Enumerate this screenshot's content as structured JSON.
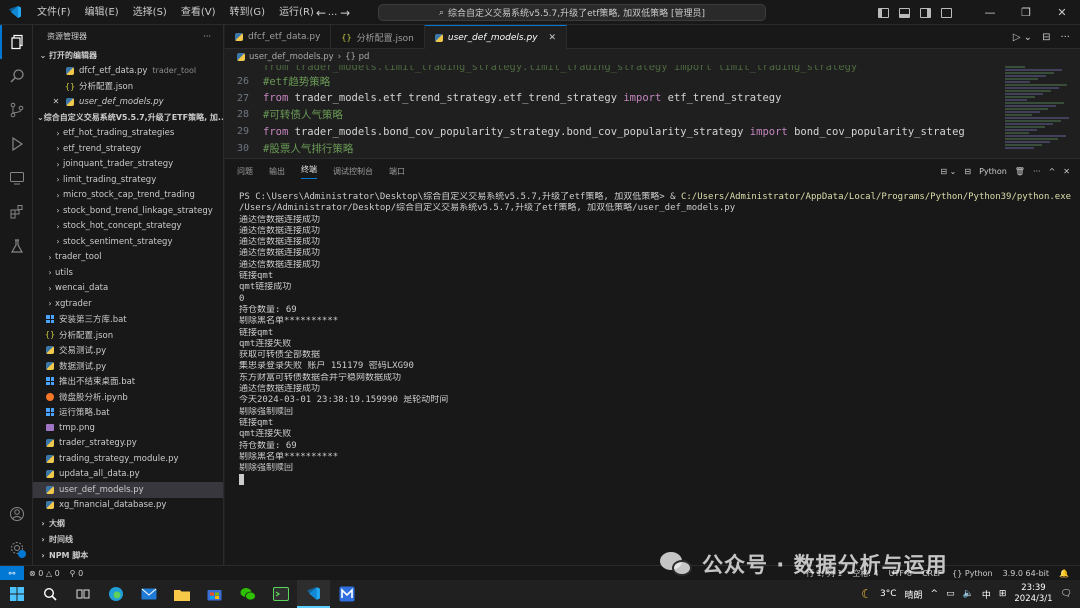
{
  "titlebar": {
    "menu": [
      "文件(F)",
      "编辑(E)",
      "选择(S)",
      "查看(V)",
      "转到(G)",
      "运行(R)",
      "..."
    ],
    "command_center": "综合自定义交易系统v5.5.7,升级了etf策略, 加双低策略 [管理员]"
  },
  "sidebar": {
    "title": "资源管理器",
    "open_editors_title": "打开的编辑器",
    "open_editors": [
      {
        "name": "dfcf_etf_data.py",
        "hint": "trader_tool",
        "icon": "python-file-icon"
      },
      {
        "name": "分析配置.json",
        "hint": "",
        "icon": "json-file-icon"
      },
      {
        "name": "user_def_models.py",
        "hint": "",
        "icon": "python-file-icon",
        "close": "✕"
      }
    ],
    "workspace_title": "综合自定义交易系统V5.5.7,升级了ETF策略, 加...",
    "tree": [
      {
        "name": "etf_hot_trading_strategies",
        "type": "folder"
      },
      {
        "name": "etf_trend_strategy",
        "type": "folder"
      },
      {
        "name": "joinquant_trader_strategy",
        "type": "folder"
      },
      {
        "name": "limit_trading_strategy",
        "type": "folder"
      },
      {
        "name": "micro_stock_cap_trend_trading",
        "type": "folder"
      },
      {
        "name": "stock_bond_trend_linkage_strategy",
        "type": "folder"
      },
      {
        "name": "stock_hot_concept_strategy",
        "type": "folder"
      },
      {
        "name": "stock_sentiment_strategy",
        "type": "folder"
      }
    ],
    "root_items": [
      {
        "name": "trader_tool",
        "type": "folder"
      },
      {
        "name": "utils",
        "type": "folder"
      },
      {
        "name": "wencai_data",
        "type": "folder"
      },
      {
        "name": "xgtrader",
        "type": "folder"
      },
      {
        "name": "安装第三方库.bat",
        "type": "bat"
      },
      {
        "name": "分析配置.json",
        "type": "json"
      },
      {
        "name": "交易测试.py",
        "type": "py"
      },
      {
        "name": "数据测试.py",
        "type": "py"
      },
      {
        "name": "推出不结束桌面.bat",
        "type": "bat"
      },
      {
        "name": "微盘股分析.ipynb",
        "type": "ipynb"
      },
      {
        "name": "运行策略.bat",
        "type": "bat"
      },
      {
        "name": "tmp.png",
        "type": "png"
      },
      {
        "name": "trader_strategy.py",
        "type": "py"
      },
      {
        "name": "trading_strategy_module.py",
        "type": "py"
      },
      {
        "name": "updata_all_data.py",
        "type": "py"
      },
      {
        "name": "user_def_models.py",
        "type": "py",
        "selected": true
      },
      {
        "name": "xg_financial_database.py",
        "type": "py"
      }
    ],
    "bottom_sections": [
      "大纲",
      "时间线",
      "NPM 脚本"
    ]
  },
  "editor": {
    "tabs": [
      {
        "label": "dfcf_etf_data.py",
        "active": false
      },
      {
        "label": "分析配置.json",
        "active": false
      },
      {
        "label": "user_def_models.py",
        "active": true
      }
    ],
    "breadcrumb": [
      "user_def_models.py",
      "{} pd"
    ],
    "lines": [
      {
        "num": "26",
        "kind": "comment",
        "text": "#etf趋势策略"
      },
      {
        "num": "27",
        "kind": "import",
        "from": "from",
        "module": "trader_models.etf_trend_strategy.etf_trend_strategy",
        "imp": "import",
        "name": "etf_trend_strategy"
      },
      {
        "num": "28",
        "kind": "comment",
        "text": "#可转债人气策略"
      },
      {
        "num": "29",
        "kind": "import",
        "from": "from",
        "module": "trader_models.bond_cov_popularity_strategy.bond_cov_popularity_strategy",
        "imp": "import",
        "name": "bond_cov_popularity_strateg"
      },
      {
        "num": "30",
        "kind": "comment",
        "text": "#股票人气排行策略"
      }
    ]
  },
  "panel": {
    "tabs": [
      "问题",
      "输出",
      "终端",
      "调试控制台",
      "端口"
    ],
    "active_tab": "终端",
    "shell_label": "Python",
    "prompt": "PS C:\\Users\\Administrator\\Desktop\\综合自定义交易系统v5.5.7,升级了etf策略, 加双低策略> & ",
    "python_path": "C:/Users/Administrator/AppData/Local/Programs/Python/Python39/python.exe",
    "prompt_tail": " c:",
    "script_path": "/Users/Administrator/Desktop/综合自定义交易系统v5.5.7,升级了etf策略, 加双低策略/user_def_models.py",
    "output": [
      "通达信数据连接成功",
      "通达信数据连接成功",
      "通达信数据连接成功",
      "通达信数据连接成功",
      "通达信数据连接成功",
      "链接qmt",
      "qmt链接成功",
      "0",
      "持仓数量: 69",
      "剔除黑名单**********",
      "链接qmt",
      "qmt连接失败",
      "获取可转债全部数据",
      "集思录登录失败 账户 151179 密码LXG90",
      "东方财富可转债数据合并宁稳网数据成功",
      "通达信数据连接成功",
      "今天2024-03-01 23:38:19.159990 是轮动时间",
      "剔除强制赎回",
      "链接qmt",
      "qmt连接失败",
      "持仓数量: 69",
      "剔除黑名单**********",
      "剔除强制赎回"
    ]
  },
  "statusbar": {
    "errors": "⊗ 0 △ 0",
    "ports": "⚲ 0",
    "position": "行 1, 列 1",
    "spaces": "空格: 4",
    "encoding": "UTF-8",
    "eol": "CRLF",
    "language": "{} Python",
    "interpreter": "3.9.0 64-bit"
  },
  "watermark": {
    "text": "公众号 · 数据分析与运用"
  },
  "taskbar": {
    "weather_temp": "3°C",
    "weather_text": "晴朗",
    "ime": "中",
    "time": "23:39",
    "date": "2024/3/1"
  },
  "colors": {
    "accent": "#0078d4",
    "comment": "#6a9955",
    "keyword": "#c586c0",
    "module": "#4ec9b0"
  }
}
